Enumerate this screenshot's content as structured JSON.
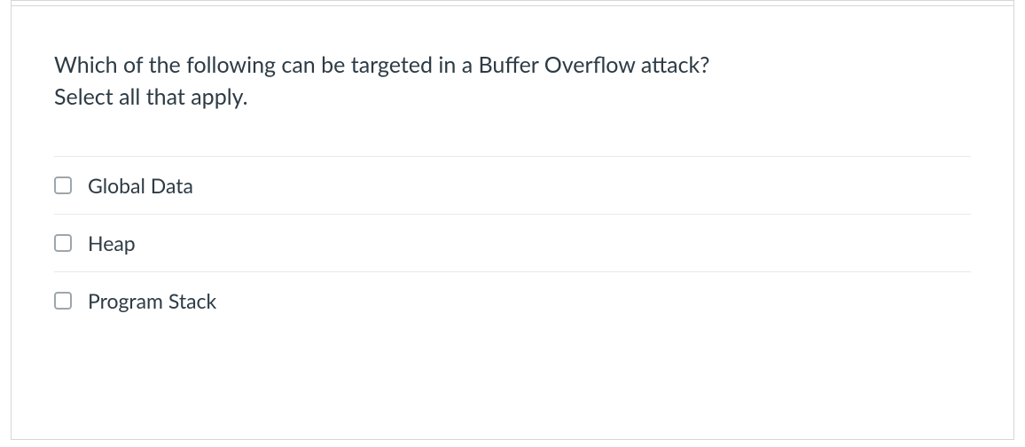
{
  "question": {
    "line1": "Which of the following can be targeted in a Buffer Overflow attack?",
    "line2": "Select all that apply."
  },
  "options": [
    {
      "label": "Global Data"
    },
    {
      "label": "Heap"
    },
    {
      "label": "Program Stack"
    }
  ]
}
